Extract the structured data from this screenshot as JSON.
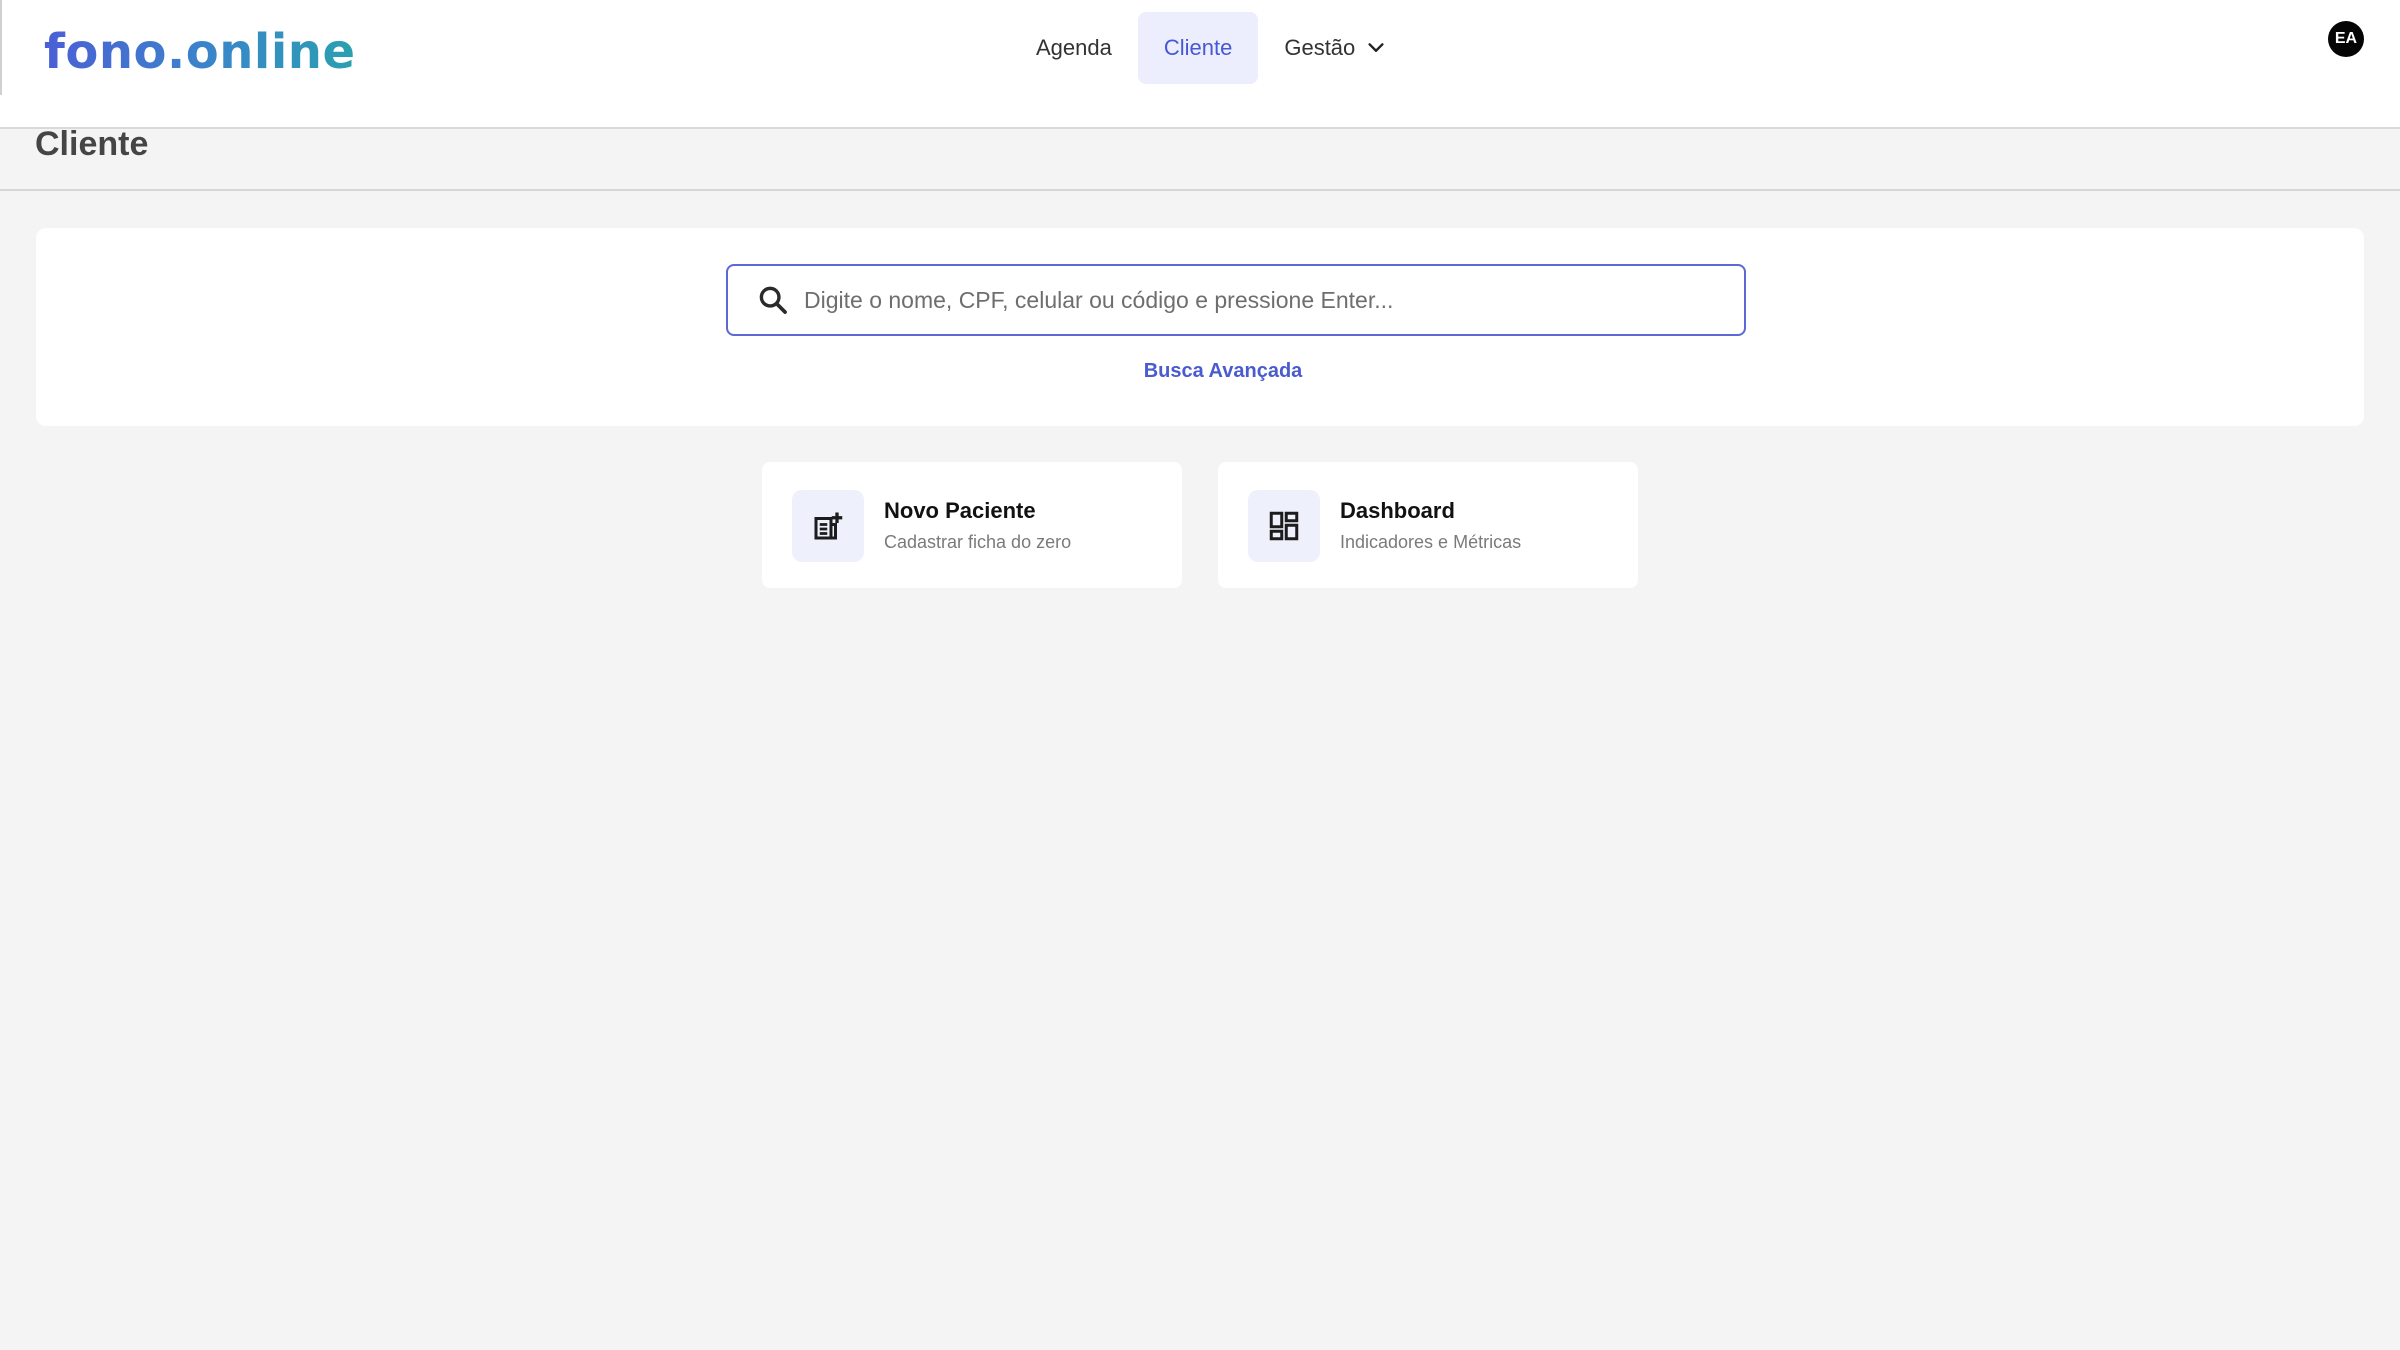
{
  "header": {
    "logo": "fono.online",
    "nav": [
      {
        "label": "Agenda"
      },
      {
        "label": "Cliente",
        "active": true
      },
      {
        "label": "Gestão",
        "has_dropdown": true
      }
    ],
    "avatar_initials": "EA"
  },
  "page": {
    "title": "Cliente"
  },
  "search": {
    "placeholder": "Digite o nome, CPF, celular ou código e pressione Enter...",
    "value": "",
    "advanced_link": "Busca Avançada"
  },
  "actions": [
    {
      "title": "Novo Paciente",
      "subtitle": "Cadastrar ficha do zero",
      "icon": "note-add-icon"
    },
    {
      "title": "Dashboard",
      "subtitle": "Indicadores e Métricas",
      "icon": "dashboard-icon"
    }
  ],
  "colors": {
    "accent": "#4658d4",
    "nav_active_bg": "#eceefd",
    "page_bg": "#f4f4f4"
  }
}
